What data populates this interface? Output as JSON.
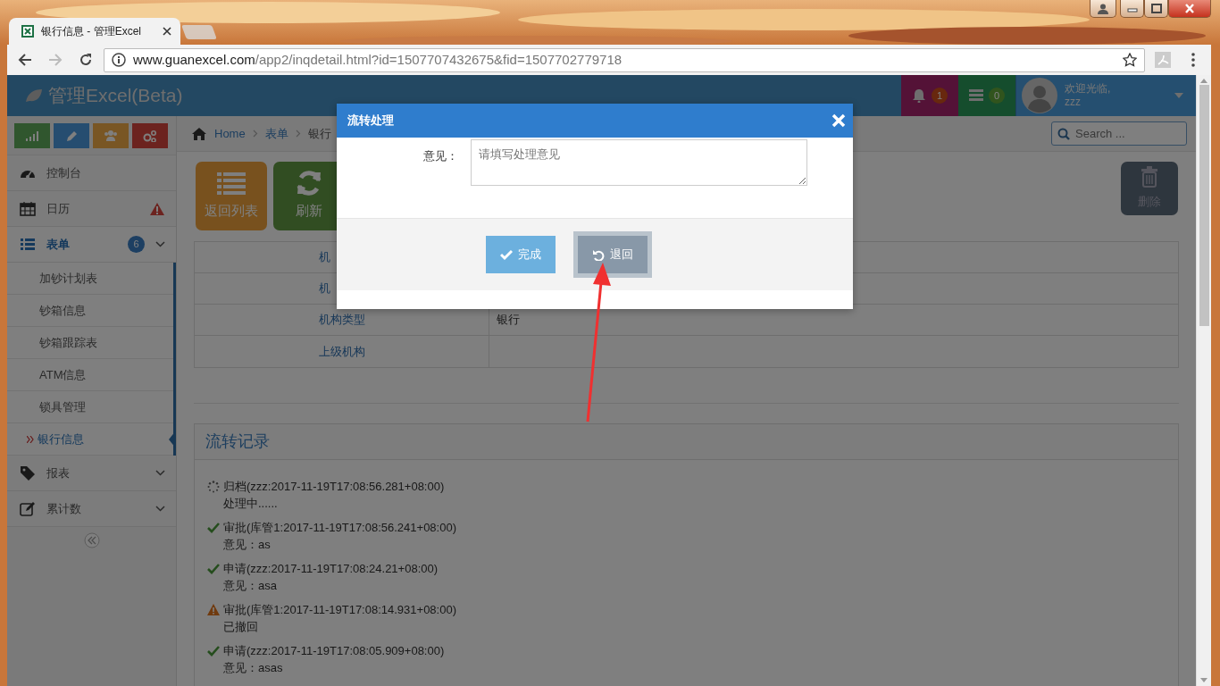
{
  "browser": {
    "tabs": [
      {
        "title": "银行信息 - 管理Excel",
        "selected": true
      },
      {
        "selected": false
      }
    ],
    "address": {
      "host": "www.guanexcel.com",
      "path": "/app2/inqdetail.html?id=1507707432675&fid=1507702779718"
    }
  },
  "header": {
    "brand": "管理Excel(Beta)",
    "notifications": "1",
    "tasks": "0",
    "greeting": "欢迎光临,",
    "user": "zzz"
  },
  "shortcuts": [
    {
      "kind": "chart"
    },
    {
      "kind": "pencil"
    },
    {
      "kind": "users"
    },
    {
      "kind": "cogs"
    }
  ],
  "sidebar": {
    "items": [
      {
        "kind": "dashboard",
        "label": "控制台",
        "selected": false,
        "warning": false,
        "collapsible": false
      },
      {
        "kind": "calendar",
        "label": "日历",
        "selected": false,
        "warning": true,
        "collapsible": false
      },
      {
        "kind": "list",
        "label": "表单",
        "selected": true,
        "warning": false,
        "collapsible": true,
        "badge": "6",
        "children": [
          {
            "label": "加钞计划表",
            "selected": false
          },
          {
            "label": "钞箱信息",
            "selected": false
          },
          {
            "label": "钞箱跟踪表",
            "selected": false
          },
          {
            "label": "ATM信息",
            "selected": false
          },
          {
            "label": "锁具管理",
            "selected": false
          },
          {
            "label": "银行信息",
            "selected": true
          }
        ]
      },
      {
        "kind": "tag",
        "label": "报表",
        "selected": false,
        "warning": false,
        "collapsible": true
      },
      {
        "kind": "edit",
        "label": "累计数",
        "selected": false,
        "warning": false,
        "collapsible": true
      }
    ]
  },
  "breadcrumb": [
    "Home",
    "表单",
    "银行"
  ],
  "search": {
    "placeholder": "Search ..."
  },
  "toolbar": [
    {
      "kind": "list",
      "label": "返回列表"
    },
    {
      "kind": "refresh",
      "label": "刷新"
    },
    {
      "kind": "delete",
      "label": "删除"
    }
  ],
  "details": [
    {
      "label": "机"
    },
    {
      "label": "机"
    },
    {
      "label": "机构类型",
      "value": "银行"
    },
    {
      "label": "上级机构"
    }
  ],
  "flow_log": {
    "title": "流转记录",
    "entries": [
      {
        "kind": "pending",
        "title": "归档(zzz:2017-11-19T17:08:56.281+08:00)",
        "note": "处理中......"
      },
      {
        "kind": "done",
        "title": "审批(库管1:2017-11-19T17:08:56.241+08:00)",
        "note": "意见：as"
      },
      {
        "kind": "done",
        "title": "申请(zzz:2017-11-19T17:08:24.21+08:00)",
        "note": "意见：asa"
      },
      {
        "kind": "warning",
        "title": "审批(库管1:2017-11-19T17:08:14.931+08:00)",
        "note": "已撤回"
      },
      {
        "kind": "done",
        "title": "申请(zzz:2017-11-19T17:08:05.909+08:00)",
        "note": "意见：asas"
      }
    ]
  },
  "dialog": {
    "title": "流转处理",
    "field_label": "意见：",
    "placeholder": "请填写处理意见",
    "buttons": [
      {
        "kind": "confirm",
        "label": "完成",
        "focused": false
      },
      {
        "kind": "back",
        "label": "退回",
        "focused": true
      }
    ]
  }
}
